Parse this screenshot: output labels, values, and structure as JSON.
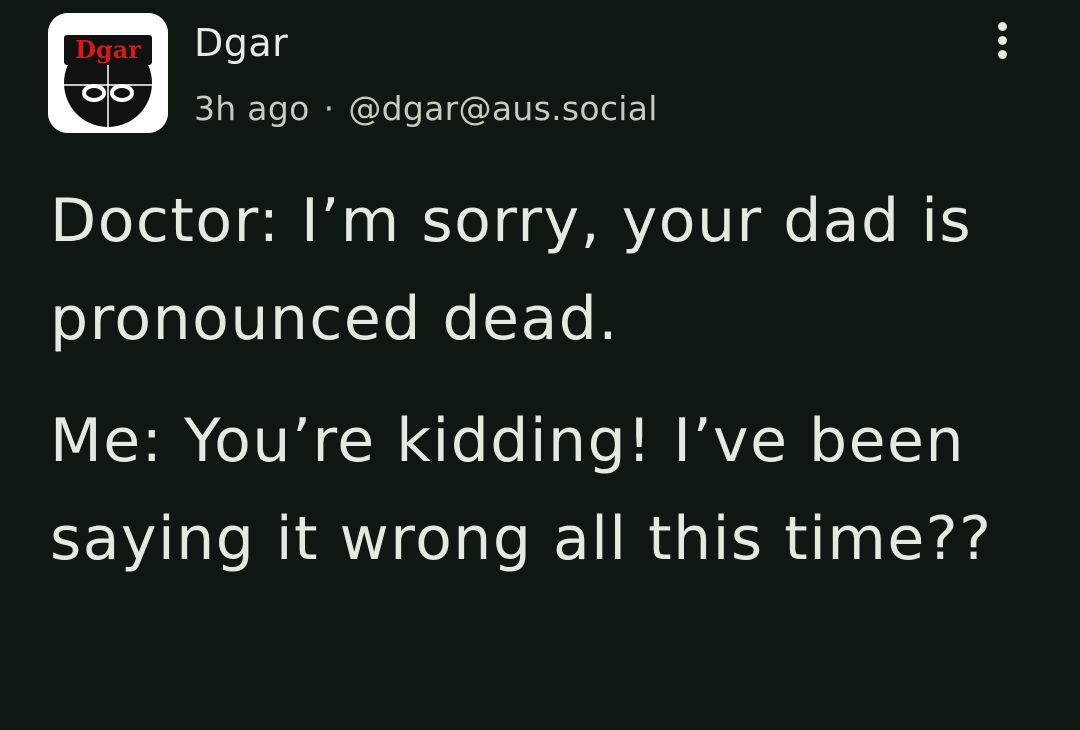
{
  "post": {
    "author": {
      "avatar_text": "Dgar",
      "display_name": "Dgar",
      "handle": "@dgar@aus.social"
    },
    "timestamp": "3h ago",
    "separator": "·",
    "menu_icon": "more-vertical-icon",
    "paragraphs": [
      "Doctor: I’m sorry, your dad is pronounced dead.",
      "Me: You’re kidding! I’ve been saying it wrong all this time??"
    ]
  },
  "colors": {
    "background": "#0f1713",
    "text": "#e3eadf",
    "meta_text": "#c4ccbf",
    "avatar_accent": "#d11a1a"
  }
}
